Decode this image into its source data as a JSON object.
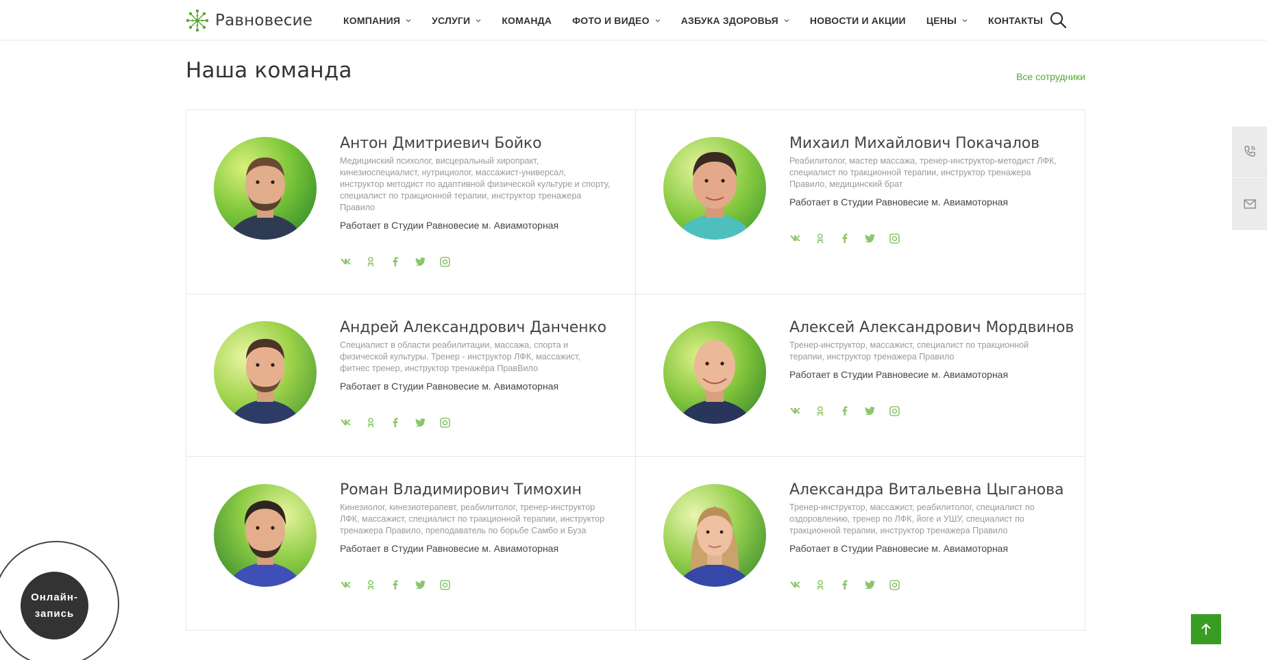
{
  "brand": {
    "logo_text": "Равновесие",
    "accent": "#55a62f",
    "green_button": "#3a9d23"
  },
  "nav": [
    {
      "label": "КОМПАНИЯ",
      "has_dropdown": true
    },
    {
      "label": "УСЛУГИ",
      "has_dropdown": true
    },
    {
      "label": "КОМАНДА",
      "has_dropdown": false
    },
    {
      "label": "ФОТО И ВИДЕО",
      "has_dropdown": true
    },
    {
      "label": "АЗБУКА ЗДОРОВЬЯ",
      "has_dropdown": true
    },
    {
      "label": "НОВОСТИ И АКЦИИ",
      "has_dropdown": false
    },
    {
      "label": "ЦЕНЫ",
      "has_dropdown": true
    },
    {
      "label": "КОНТАКТЫ",
      "has_dropdown": false
    }
  ],
  "icons": {
    "search": "search-icon",
    "phone": "phone-icon",
    "mail": "mail-icon",
    "scroll_up": "arrow-up-icon"
  },
  "page": {
    "title": "Наша команда",
    "all_link": "Все сотрудники"
  },
  "team": [
    {
      "name": "Антон Дмитриевич Бойко",
      "description": "Медицинский психолог, висцеральный хиропракт, кинезиоспециалист, нутрициолог, массажист-универсал, инструктор методист по адаптивной физической культуре и спорту, специалист по тракционной терапии, инструктор тренажера Правило",
      "works": "Работает в Студии Равновесие м. Авиамоторная"
    },
    {
      "name": "Михаил Михайлович Покачалов",
      "description": "Реабилитолог, мастер массажа, тренер-инструктор-методист ЛФК, специалист по тракционной терапии, инструктор тренажера Правило, медицинский брат",
      "works": "Работает в Студии Равновесие м. Авиамоторная"
    },
    {
      "name": "Андрей Александрович Данченко",
      "description": "Специалист в области реабилитации, массажа, спорта и физической культуры. Тренер - инструктор ЛФК, массажист, фитнес тренер, инструктор тренажёра ПравВило",
      "works": "Работает в Студии Равновесие м. Авиамоторная"
    },
    {
      "name": "Алексей Александрович Мордвинов",
      "description": "Тренер-инструктор, массажист, специалист по тракционной терапии, инструктор тренажера Правило",
      "works": "Работает в Студии Равновесие м. Авиамоторная"
    },
    {
      "name": "Роман Владимирович Тимохин",
      "description": "Кинезиолог, кинезиотерапевт, реабилитолог, тренер-инструктор ЛФК, массажист, специалист по тракционной терапии, инструктор тренажера Правило, преподаватель по борьбе Самбо и Буза",
      "works": "Работает в Студии Равновесие м. Авиамоторная"
    },
    {
      "name": "Александра Витальевна Цыганова",
      "description": "Тренер-инструктор, массажист, реабилитолог, специалист по оздоровлению, тренер по ЛФК, йоге и УШУ, специалист по тракционной терапии, инструктор тренажера Правило",
      "works": "Работает в Студии Равновесие м. Авиамоторная"
    }
  ],
  "socials": [
    "vk-icon",
    "odnoklassniki-icon",
    "facebook-icon",
    "twitter-icon",
    "instagram-icon"
  ],
  "online": {
    "line1": "Онлайн-",
    "line2": "запись"
  }
}
